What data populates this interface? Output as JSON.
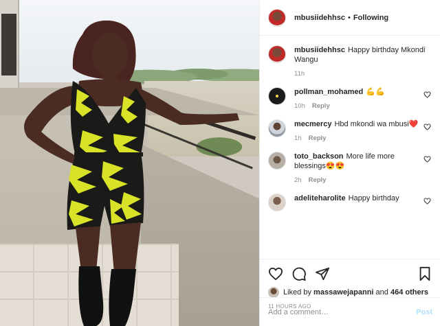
{
  "post": {
    "author": "mbusiidehhsc",
    "follow_state": "Following",
    "separator": "•"
  },
  "caption": {
    "username": "mbusiidehhsc",
    "text": "Happy birthday Mkondi Wangu",
    "time": "11h"
  },
  "comments": [
    {
      "username": "pollman_mohamed",
      "text": "💪💪",
      "time": "10h",
      "reply": "Reply"
    },
    {
      "username": "mecmercy",
      "text": "Hbd mkondi wa mbusi❤️",
      "time": "1h",
      "reply": "Reply"
    },
    {
      "username": "toto_backson",
      "text": "More life more blessings😍😍",
      "time": "2h",
      "reply": "Reply"
    },
    {
      "username": "adeliteharolite",
      "text": "Happy birthday",
      "time": "",
      "reply": ""
    }
  ],
  "likes": {
    "prefix": "Liked by",
    "user": "massawejapanni",
    "and": "and",
    "count": "464 others"
  },
  "timestamp": "11 HOURS AGO",
  "add_comment": {
    "placeholder": "Add a comment…",
    "post_label": "Post"
  },
  "colors": {
    "post_disabled": "#b2dffc",
    "muted": "#8e8e8e",
    "text": "#262626"
  },
  "icons": {
    "like": "heart-icon",
    "comment": "comment-icon",
    "share": "share-icon",
    "save": "bookmark-icon",
    "more": "more-options-icon"
  }
}
